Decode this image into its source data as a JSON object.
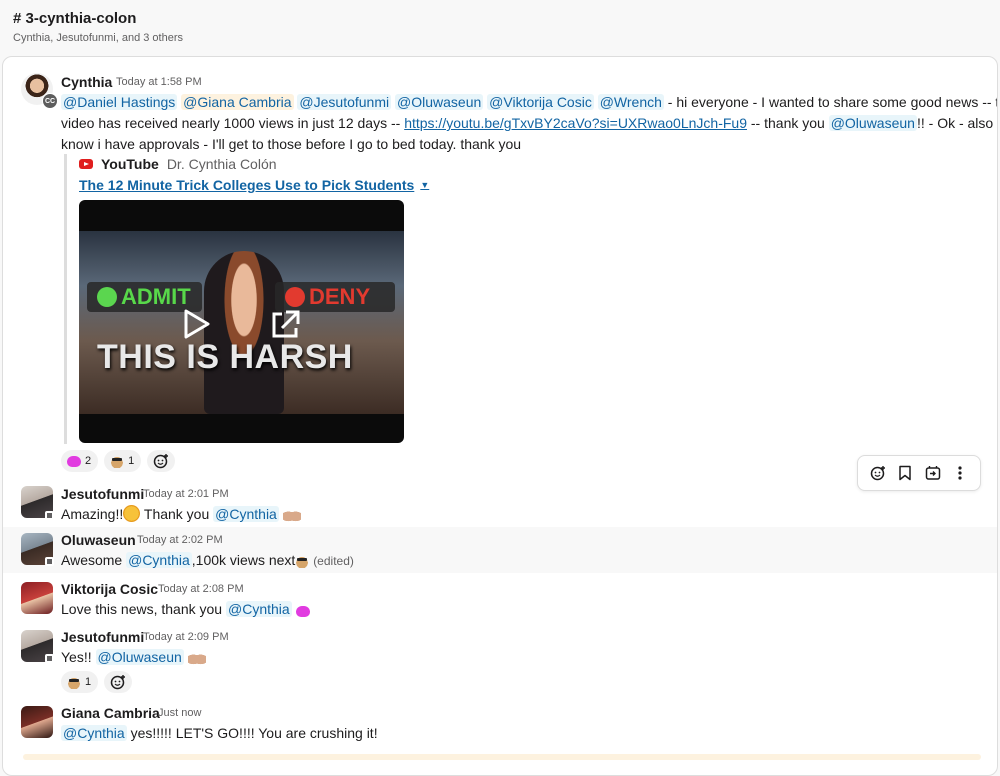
{
  "channel": {
    "title": "# 3-cynthia-colon",
    "members": "Cynthia, Jesutofunmi, and 3 others"
  },
  "messages": [
    {
      "author": "Cynthia",
      "time": "Today at 1:58 PM",
      "avatar_badge": "CC",
      "mentions": [
        "@Daniel Hastings",
        "@Giana Cambria",
        "@Jesutofunmi",
        "@Oluwaseun",
        "@Viktorija Cosic",
        "@Wrench"
      ],
      "text_1": " - hi everyone - I wanted to share some good news -- this",
      "text_2": "video has received nearly 1000 views in just 12 days -- ",
      "link": "https://youtu.be/gTxvBY2caVo?si=UXRwao0LnJch-Fu9",
      "text_3": "  -- thank you ",
      "mention_end": "@Oluwaseun",
      "text_4": "!!   - Ok - also - I",
      "text_5": "know i have approvals - I'll get to those before I go to bed today. thank you",
      "unfurl": {
        "source": "YouTube",
        "author": "Dr. Cynthia Colón",
        "title": "The 12 Minute Trick Colleges Use to Pick Students",
        "thumb_admit": "ADMIT",
        "thumb_deny": "DENY",
        "thumb_caption": "THIS IS HARSH"
      },
      "reactions": [
        {
          "emoji": "pink-blob",
          "count": "2"
        },
        {
          "emoji": "dog-sunglasses",
          "count": "1"
        }
      ]
    },
    {
      "author": "Jesutofunmi",
      "time": "Today at 2:01 PM",
      "text_1": "Amazing!!",
      "text_2": " Thank you ",
      "mention": "@Cynthia"
    },
    {
      "author": "Oluwaseun",
      "time": "Today at 2:02 PM",
      "text_1": "Awesome ",
      "mention": "@Cynthia",
      "text_2": ",100k views next",
      "edited": "(edited)"
    },
    {
      "author": "Viktorija Cosic",
      "time": "Today at 2:08 PM",
      "text_1": "Love this news, thank you ",
      "mention": "@Cynthia"
    },
    {
      "author": "Jesutofunmi",
      "time": "Today at 2:09 PM",
      "text_1": "Yes!! ",
      "mention": "@Oluwaseun",
      "reactions": [
        {
          "emoji": "dog-sunglasses",
          "count": "1"
        }
      ]
    },
    {
      "author": "Giana Cambria",
      "time": "Just now",
      "mention": "@Cynthia",
      "text_1": " yes!!!!! LET'S GO!!!! You are crushing it!"
    }
  ],
  "hover_toolbar": [
    "add-reaction-icon",
    "bookmark-icon",
    "forward-icon",
    "more-icon"
  ]
}
